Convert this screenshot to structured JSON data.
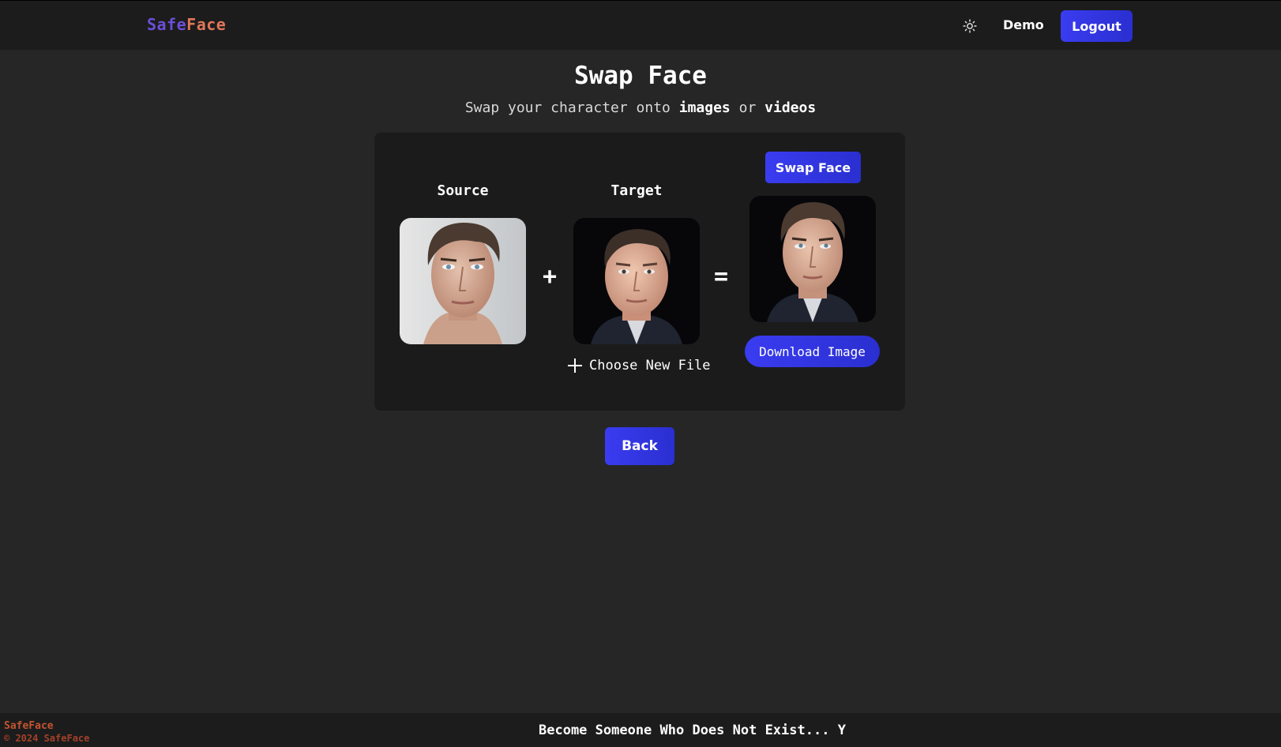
{
  "navbar": {
    "logo_part1": "Safe",
    "logo_part2": "Face",
    "theme_icon": "sun-icon",
    "demo_label": "Demo",
    "logout_label": "Logout"
  },
  "header": {
    "title": "Swap Face",
    "subtitle_prefix": "Swap your character onto ",
    "subtitle_images": "images",
    "subtitle_or": " or ",
    "subtitle_videos": "videos"
  },
  "swap": {
    "source_label": "Source",
    "target_label": "Target",
    "plus_symbol": "+",
    "equals_symbol": "=",
    "choose_file_label": "Choose New File",
    "swap_button_label": "Swap Face",
    "download_label": "Download Image"
  },
  "back_label": "Back",
  "footer": {
    "brand": "SafeFace",
    "copyright": "© 2024 SafeFace",
    "marquee": "Become Someone Who Does Not Exist... Y"
  },
  "colors": {
    "accent": "#3a3cf0",
    "logo_safe": "#6b4fd8",
    "logo_face": "#e0765a",
    "footer_brand": "#c4542f",
    "background": "#262626",
    "card": "#1b1b1b"
  }
}
